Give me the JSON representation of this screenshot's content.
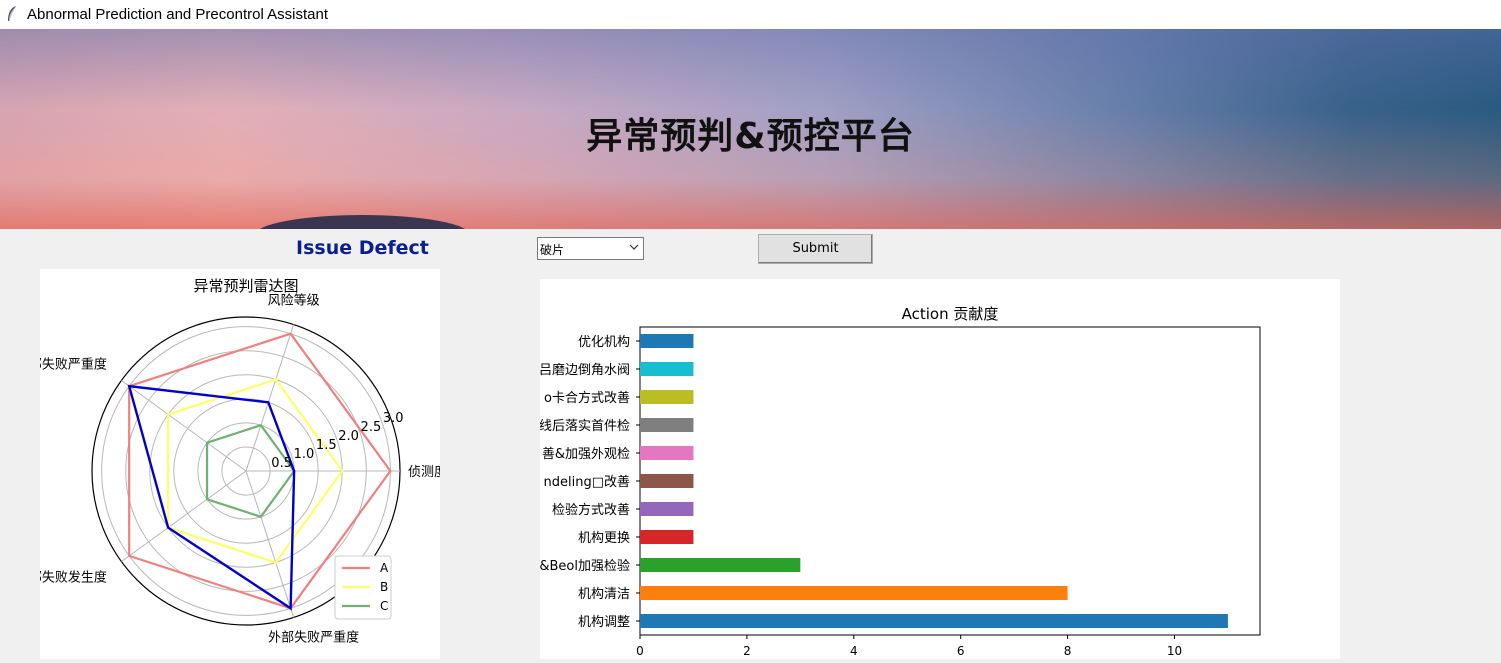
{
  "window": {
    "title": "Abnormal Prediction and Precontrol Assistant"
  },
  "banner": {
    "heading": "异常预判&预控平台"
  },
  "form": {
    "section_label": "Issue Defect",
    "defect_select_value": "破片",
    "submit_label": "Submit"
  },
  "colors": {
    "accent_label": "#0a1f8f",
    "series_A": "#f08080",
    "series_B": "#ffff66",
    "series_C": "#70b070",
    "series_blue": "#0000cc"
  },
  "chart_data": [
    {
      "type": "radar",
      "title": "异常预判雷达图",
      "axes": [
        "侦测度",
        "风险等级",
        "内部失败严重度",
        "外部失败发生度",
        "外部失败严重度"
      ],
      "radial_ticks": [
        "0.5",
        "1.0",
        "1.5",
        "2.0",
        "2.5",
        "3.0"
      ],
      "rmax": 3.2,
      "series": [
        {
          "name": "A",
          "values": [
            3,
            3,
            3,
            3,
            3
          ],
          "color": "#f08080"
        },
        {
          "name": "B",
          "values": [
            2,
            2,
            2,
            2,
            2
          ],
          "color": "#ffff66"
        },
        {
          "name": "C",
          "values": [
            1,
            1,
            1,
            1,
            1
          ],
          "color": "#70b070"
        },
        {
          "name": "",
          "values": [
            1,
            1.5,
            3,
            2,
            3
          ],
          "color": "#0000cc"
        }
      ],
      "legend": "bottom-right"
    },
    {
      "type": "bar",
      "orientation": "horizontal",
      "title": "Action 贡献度",
      "categories": [
        "机构调整",
        "机构清洁",
        "&Beol加强检验",
        "机构更换",
        "检验方式改善",
        "ndeling□改善",
        "善&加强外观检",
        "线后落实首件检",
        "o卡合方式改善",
        "吕磨边倒角水阀",
        "优化机构"
      ],
      "values": [
        11,
        8,
        3,
        1,
        1,
        1,
        1,
        1,
        1,
        1,
        1
      ],
      "colors": [
        "#1f77b4",
        "#ff7f0e",
        "#2ca02c",
        "#d62728",
        "#9467bd",
        "#8c564b",
        "#e377c2",
        "#7f7f7f",
        "#bcbd22",
        "#17becf",
        "#1f77b4"
      ],
      "xticks": [
        "0",
        "2",
        "4",
        "6",
        "8",
        "10"
      ],
      "xlim": [
        0,
        11.6
      ]
    }
  ]
}
